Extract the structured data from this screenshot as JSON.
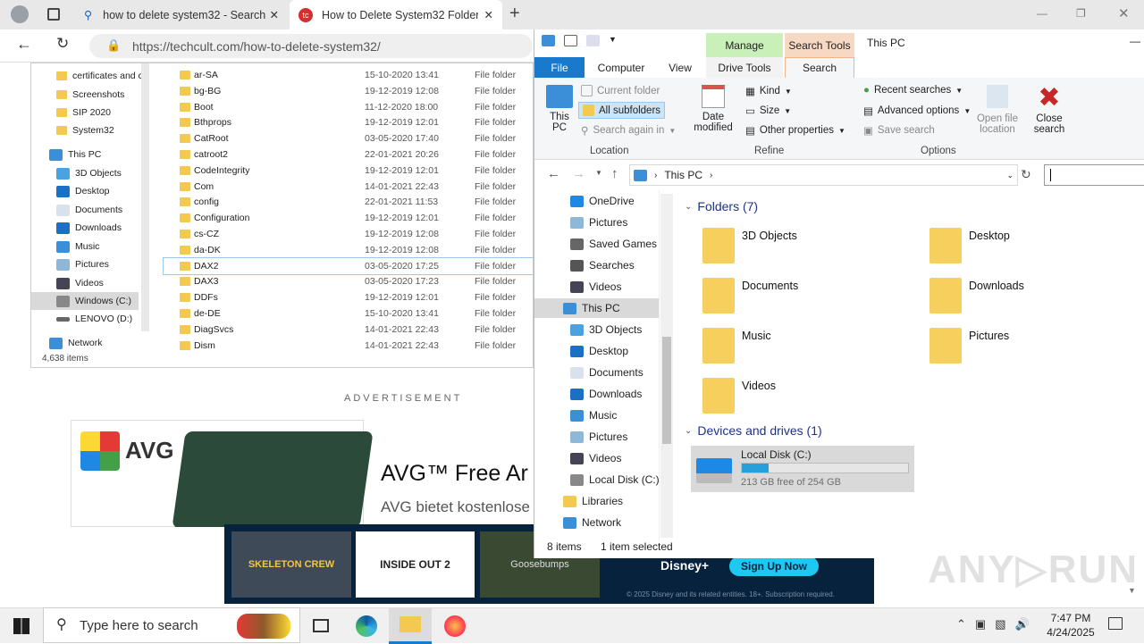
{
  "browser": {
    "tabs": [
      {
        "label": "how to delete system32 - Search"
      },
      {
        "label": "How to Delete System32 Folder in"
      }
    ],
    "url": "https://techcult.com/how-to-delete-system32/",
    "url_domain": "techcult.com"
  },
  "page": {
    "nav_items": [
      "certificates and c",
      "Screenshots",
      "SIP 2020",
      "System32",
      "This PC",
      "3D Objects",
      "Desktop",
      "Documents",
      "Downloads",
      "Music",
      "Pictures",
      "Videos",
      "Windows (C:)",
      "LENOVO (D:)",
      "Network"
    ],
    "items_count": "4,638 items",
    "files": [
      {
        "name": "ar-SA",
        "date": "15-10-2020 13:41",
        "type": "File folder"
      },
      {
        "name": "bg-BG",
        "date": "19-12-2019 12:08",
        "type": "File folder"
      },
      {
        "name": "Boot",
        "date": "11-12-2020 18:00",
        "type": "File folder"
      },
      {
        "name": "Bthprops",
        "date": "19-12-2019 12:01",
        "type": "File folder"
      },
      {
        "name": "CatRoot",
        "date": "03-05-2020 17:40",
        "type": "File folder"
      },
      {
        "name": "catroot2",
        "date": "22-01-2021 20:26",
        "type": "File folder"
      },
      {
        "name": "CodeIntegrity",
        "date": "19-12-2019 12:01",
        "type": "File folder"
      },
      {
        "name": "Com",
        "date": "14-01-2021 22:43",
        "type": "File folder"
      },
      {
        "name": "config",
        "date": "22-01-2021 11:53",
        "type": "File folder"
      },
      {
        "name": "Configuration",
        "date": "19-12-2019 12:01",
        "type": "File folder"
      },
      {
        "name": "cs-CZ",
        "date": "19-12-2019 12:08",
        "type": "File folder"
      },
      {
        "name": "da-DK",
        "date": "19-12-2019 12:08",
        "type": "File folder"
      },
      {
        "name": "DAX2",
        "date": "03-05-2020 17:25",
        "type": "File folder"
      },
      {
        "name": "DAX3",
        "date": "03-05-2020 17:23",
        "type": "File folder"
      },
      {
        "name": "DDFs",
        "date": "19-12-2019 12:01",
        "type": "File folder"
      },
      {
        "name": "de-DE",
        "date": "15-10-2020 13:41",
        "type": "File folder"
      },
      {
        "name": "DiagSvcs",
        "date": "14-01-2021 22:43",
        "type": "File folder"
      },
      {
        "name": "Dism",
        "date": "14-01-2021 22:43",
        "type": "File folder"
      }
    ],
    "advertisement": "ADVERTISEMENT",
    "ad_brand": "AVG",
    "ad_title": "AVG™ Free Ar",
    "ad_sub": "AVG bietet kostenlose",
    "banner_cta": "Sign Up Now",
    "banner_brand": "Disney+",
    "banner_legal": "© 2025 Disney and its related entities. 18+. Subscription required.",
    "banner_titles": [
      "SKELETON CREW",
      "INSIDE OUT 2",
      "Goosebumps"
    ]
  },
  "explorer": {
    "title": "This PC",
    "context_tabs": [
      "Manage",
      "Search Tools"
    ],
    "ribbon_tabs": [
      "File",
      "Computer",
      "View",
      "Drive Tools",
      "Search"
    ],
    "ribbon": {
      "this_pc": "This PC",
      "current_folder": "Current folder",
      "all_subfolders": "All subfolders",
      "search_again": "Search again in",
      "date_modified": "Date modified",
      "kind": "Kind",
      "size": "Size",
      "other_properties": "Other properties",
      "recent_searches": "Recent searches",
      "advanced_options": "Advanced options",
      "save_search": "Save search",
      "open_file_location": "Open file location",
      "close_search": "Close search",
      "groups": [
        "Location",
        "Refine",
        "Options"
      ]
    },
    "breadcrumb": "This PC",
    "tree": [
      "OneDrive",
      "Pictures",
      "Saved Games",
      "Searches",
      "Videos",
      "This PC",
      "3D Objects",
      "Desktop",
      "Documents",
      "Downloads",
      "Music",
      "Pictures",
      "Videos",
      "Local Disk (C:)",
      "Libraries",
      "Network"
    ],
    "folders_header": "Folders (7)",
    "folders": [
      "3D Objects",
      "Desktop",
      "Documents",
      "Downloads",
      "Music",
      "Pictures",
      "Videos"
    ],
    "drives_header": "Devices and drives (1)",
    "drive": {
      "name": "Local Disk (C:)",
      "free": "213 GB free of 254 GB",
      "used_fraction": 0.16
    },
    "status_items": "8 items",
    "status_selected": "1 item selected"
  },
  "taskbar": {
    "search_placeholder": "Type here to search",
    "time": "7:47 PM",
    "date": "4/24/2025"
  },
  "colors": {
    "accent": "#1979ca",
    "manage": "#c9f0b8",
    "search_tools": "#f7d8c2"
  }
}
